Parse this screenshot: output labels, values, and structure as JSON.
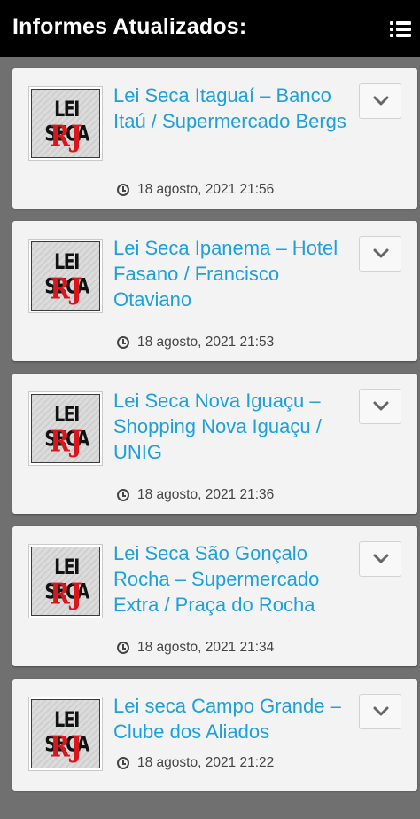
{
  "header": {
    "title": "Informes Atualizados:",
    "menu_icon": "list-menu-icon",
    "background": "#000000",
    "text_color": "#ffffff"
  },
  "colors": {
    "feed_background": "#707070",
    "card_background": "#f3f3f3",
    "title_link": "#1ea0dc",
    "date_text": "#444444",
    "logo_red": "#d8161b"
  },
  "thumbnail": {
    "icon": "lei-seca-rj-logo",
    "line1": "LEI SECA",
    "line2": "RJ"
  },
  "posts": [
    {
      "title": "Lei Seca Itaguaí – Banco Itaú / Supermercado Bergs",
      "date": "18 agosto, 2021 21:56"
    },
    {
      "title": "Lei Seca Ipanema – Hotel Fasano / Francisco Otaviano",
      "date": "18 agosto, 2021 21:53"
    },
    {
      "title": "Lei Seca Nova Iguaçu – Shopping Nova Iguaçu / UNIG",
      "date": "18 agosto, 2021 21:36"
    },
    {
      "title": "Lei Seca São Gonçalo Rocha – Supermercado Extra / Praça do Rocha",
      "date": "18 agosto, 2021 21:34"
    },
    {
      "title": "Lei seca Campo Grande – Clube dos Aliados",
      "date": "18 agosto, 2021 21:22"
    }
  ]
}
